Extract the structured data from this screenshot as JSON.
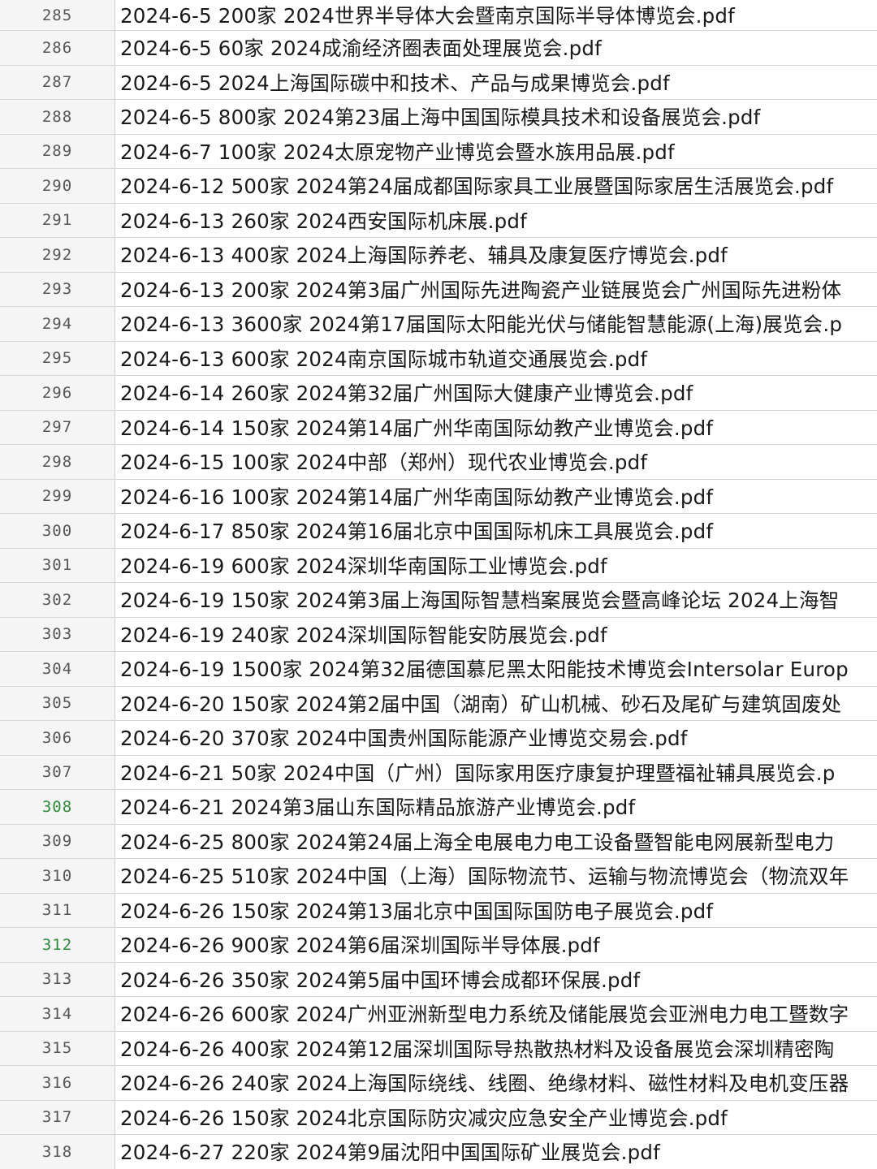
{
  "sheet": {
    "rows": [
      {
        "num": "285",
        "text": "2024-6-5 200家 2024世界半导体大会暨南京国际半导体博览会.pdf"
      },
      {
        "num": "286",
        "text": "2024-6-5 60家 2024成渝经济圈表面处理展览会.pdf"
      },
      {
        "num": "287",
        "text": "2024-6-5 2024上海国际碳中和技术、产品与成果博览会.pdf"
      },
      {
        "num": "288",
        "text": "2024-6-5 800家 2024第23届上海中国国际模具技术和设备展览会.pdf"
      },
      {
        "num": "289",
        "text": "2024-6-7 100家 2024太原宠物产业博览会暨水族用品展.pdf"
      },
      {
        "num": "290",
        "text": "2024-6-12 500家 2024第24届成都国际家具工业展暨国际家居生活展览会.pdf"
      },
      {
        "num": "291",
        "text": "2024-6-13 260家 2024西安国际机床展.pdf"
      },
      {
        "num": "292",
        "text": "2024-6-13 400家 2024上海国际养老、辅具及康复医疗博览会.pdf"
      },
      {
        "num": "293",
        "text": "2024-6-13 200家 2024第3届广州国际先进陶瓷产业链展览会广州国际先进粉体"
      },
      {
        "num": "294",
        "text": "2024-6-13 3600家 2024第17届国际太阳能光伏与储能智慧能源(上海)展览会.p"
      },
      {
        "num": "295",
        "text": "2024-6-13 600家 2024南京国际城市轨道交通展览会.pdf"
      },
      {
        "num": "296",
        "text": "2024-6-14 260家 2024第32届广州国际大健康产业博览会.pdf"
      },
      {
        "num": "297",
        "text": "2024-6-14 150家 2024第14届广州华南国际幼教产业博览会.pdf"
      },
      {
        "num": "298",
        "text": "2024-6-15 100家 2024中部（郑州）现代农业博览会.pdf"
      },
      {
        "num": "299",
        "text": "2024-6-16 100家 2024第14届广州华南国际幼教产业博览会.pdf"
      },
      {
        "num": "300",
        "text": "2024-6-17 850家 2024第16届北京中国国际机床工具展览会.pdf"
      },
      {
        "num": "301",
        "text": "2024-6-19 600家 2024深圳华南国际工业博览会.pdf"
      },
      {
        "num": "302",
        "text": "2024-6-19 150家 2024第3届上海国际智慧档案展览会暨高峰论坛 2024上海智"
      },
      {
        "num": "303",
        "text": "2024-6-19 240家 2024深圳国际智能安防展览会.pdf"
      },
      {
        "num": "304",
        "text": "2024-6-19 1500家 2024第32届德国慕尼黑太阳能技术博览会Intersolar Europ"
      },
      {
        "num": "305",
        "text": "2024-6-20 150家 2024第2届中国（湖南）矿山机械、砂石及尾矿与建筑固废处"
      },
      {
        "num": "306",
        "text": "2024-6-20 370家 2024中国贵州国际能源产业博览交易会.pdf"
      },
      {
        "num": "307",
        "text": "2024-6-21 50家 2024中国（广州）国际家用医疗康复护理暨福祉辅具展览会.p"
      },
      {
        "num": "308",
        "text": "2024-6-21 2024第3届山东国际精品旅游产业博览会.pdf"
      },
      {
        "num": "309",
        "text": "2024-6-25 800家 2024第24届上海全电展电力电工设备暨智能电网展新型电力"
      },
      {
        "num": "310",
        "text": "2024-6-25 510家 2024中国（上海）国际物流节、运输与物流博览会（物流双年"
      },
      {
        "num": "311",
        "text": "2024-6-26 150家 2024第13届北京中国国际国防电子展览会.pdf"
      },
      {
        "num": "312",
        "text": "2024-6-26 900家 2024第6届深圳国际半导体展.pdf"
      },
      {
        "num": "313",
        "text": "2024-6-26 350家 2024第5届中国环博会成都环保展.pdf"
      },
      {
        "num": "314",
        "text": "2024-6-26 600家 2024广州亚洲新型电力系统及储能展览会亚洲电力电工暨数字"
      },
      {
        "num": "315",
        "text": "2024-6-26 400家 2024第12届深圳国际导热散热材料及设备展览会深圳精密陶"
      },
      {
        "num": "316",
        "text": "2024-6-26 240家 2024上海国际绕线、线圈、绝缘材料、磁性材料及电机变压器"
      },
      {
        "num": "317",
        "text": "2024-6-26 150家 2024北京国际防灾减灾应急安全产业博览会.pdf"
      },
      {
        "num": "318",
        "text": "2024-6-27 220家 2024第9届沈阳中国国际矿业展览会.pdf"
      }
    ]
  }
}
